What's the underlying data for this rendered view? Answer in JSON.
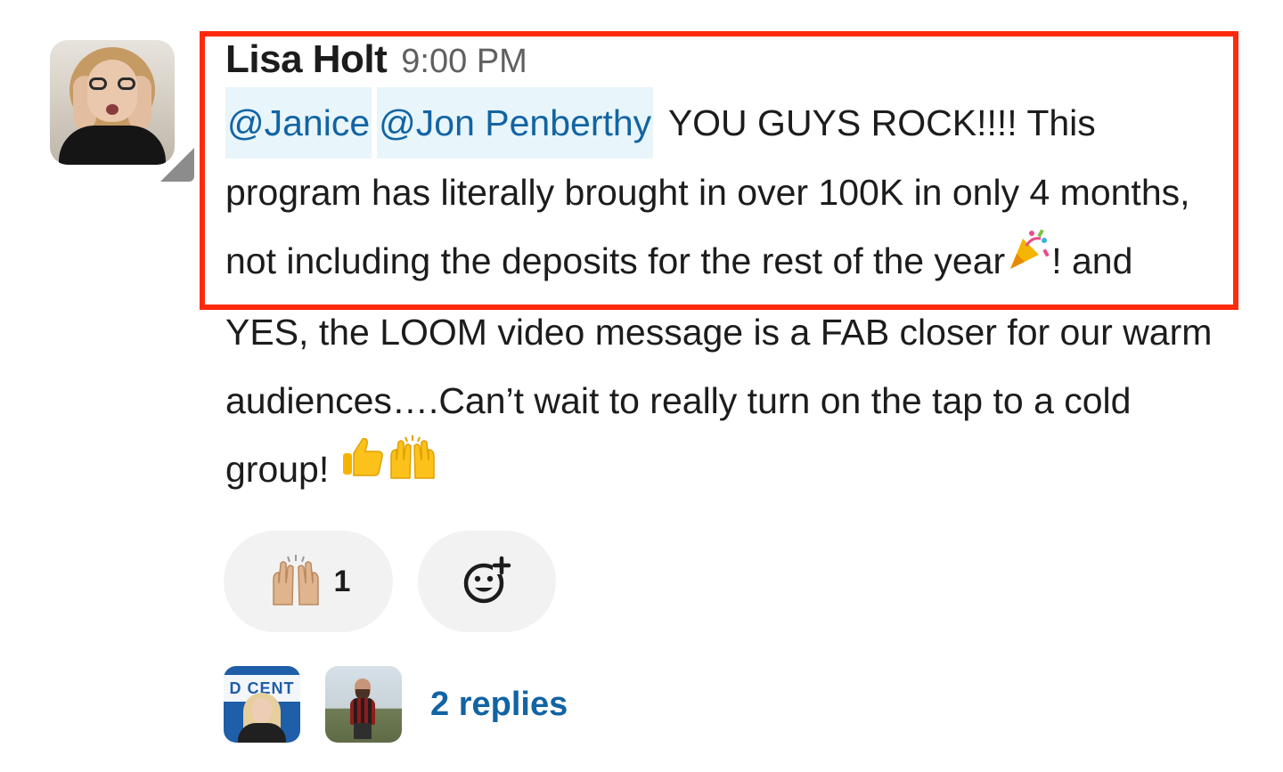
{
  "message": {
    "author": "Lisa Holt",
    "timestamp": "9:00 PM",
    "mentions": [
      "@Janice",
      "@Jon Penberthy"
    ],
    "text_part1": " YOU GUYS ROCK!!!! This program has literally brought in over 100K in only 4 months, not including the deposits for the rest of the year",
    "text_part2": "! and YES, the LOOM video message is a FAB closer for our warm audiences….Can’t wait to really turn on the tap to a cold group! ",
    "emojis": [
      "party-popper-icon",
      "thumbs-up-icon",
      "raising-hands-icon"
    ]
  },
  "reactions": [
    {
      "icon": "raising-hands-icon",
      "count": "1"
    },
    {
      "icon": "add-reaction-icon"
    }
  ],
  "thread": {
    "reply_avatars": [
      "avatar-woman-blonde",
      "avatar-man-bearded"
    ],
    "replies_label": "2 replies",
    "reply_avatar_1_sign": "D CENT"
  },
  "colors": {
    "mention_bg": "#e8f5fa",
    "mention_text": "#1264a3",
    "highlight_border": "#ff2a0d",
    "link": "#1264a3",
    "reaction_bg": "#f2f2f2"
  }
}
